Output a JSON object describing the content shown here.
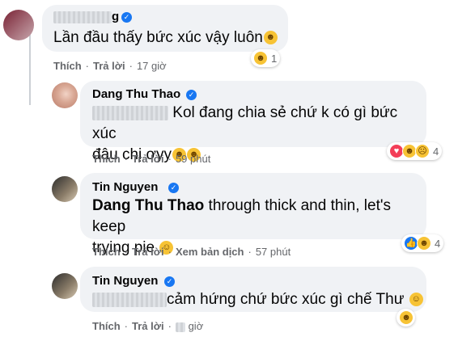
{
  "comments": [
    {
      "author_visible": "g",
      "text": "Lần đầu thấy bức xúc vậy luôn",
      "reaction_count": "1",
      "like_label": "Thích",
      "reply_label": "Trả lời",
      "time": "17 giờ"
    },
    {
      "author": "Dang Thu Thao",
      "text": "Kol đang chia sẻ chứ k có gì bức xúc đâu chị ơyy",
      "text_line1": "Kol đang chia sẻ chứ k có gì bức xúc",
      "text_line2": "đâu chị ơyy",
      "reaction_count": "4",
      "like_label": "Thích",
      "reply_label": "Trả lời",
      "time": "59 phút"
    },
    {
      "author": "Tin Nguyen",
      "mention": "Dang Thu Thao",
      "text_line1": " through thick and thin, let's keep",
      "text_line2": "trying pie",
      "reaction_count": "4",
      "like_label": "Thích",
      "reply_label": "Trả lời",
      "translate_label": "Xem bản dịch",
      "time": "57 phút"
    },
    {
      "author": "Tin Nguyen",
      "text": "cảm hứng chứ bức xúc gì chế Thư",
      "like_label": "Thích",
      "reply_label": "Trả lời",
      "time": "giờ"
    }
  ],
  "icons": [
    "verified-badge",
    "haha-reaction",
    "love-reaction",
    "sad-reaction",
    "like-reaction",
    "smile-emoji",
    "grinning-emoji"
  ],
  "colors": {
    "bubble": "#f0f2f5",
    "meta": "#65676b",
    "verified": "#1877f2"
  }
}
